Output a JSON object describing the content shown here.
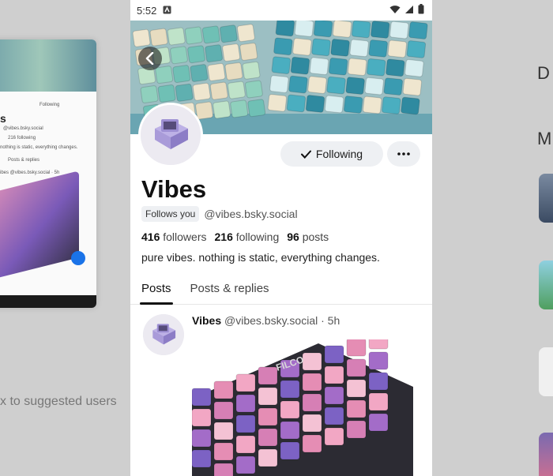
{
  "background": {
    "suggest_text": "x to suggested users",
    "right_letter_1": "D",
    "right_letter_2": "M",
    "left_phone": {
      "following_label": "Following",
      "name_fragment": "s",
      "handle": "@vibes.bsky.social",
      "stats": "216 following",
      "bio": "nothing is static, everything changes.",
      "tab": "Posts & replies",
      "post_author": "ibes @vibes.bsky.social · 5h"
    }
  },
  "status_bar": {
    "time": "5:52"
  },
  "profile": {
    "display_name": "Vibes",
    "follows_you": "Follows you",
    "handle": "@vibes.bsky.social",
    "followers_count": "416",
    "followers_label": "followers",
    "following_count": "216",
    "following_label": "following",
    "posts_count": "96",
    "posts_label": "posts",
    "bio": "pure vibes. nothing is static, everything changes.",
    "follow_button_label": "Following"
  },
  "tabs": [
    {
      "label": "Posts",
      "active": true
    },
    {
      "label": "Posts & replies",
      "active": false
    }
  ],
  "post": {
    "author_name": "Vibes",
    "author_handle": "@vibes.bsky.social",
    "time_ago": "· 5h",
    "image_brand_text": "FILCO"
  },
  "colors": {
    "accent_badge_bg": "#eef0f3",
    "avatar_purple": "#a99bd9"
  },
  "icons": {
    "back": "back-arrow-icon",
    "check": "check-icon",
    "more": "more-dots-icon",
    "wifi": "wifi-icon",
    "signal": "signal-icon",
    "battery": "battery-icon"
  }
}
